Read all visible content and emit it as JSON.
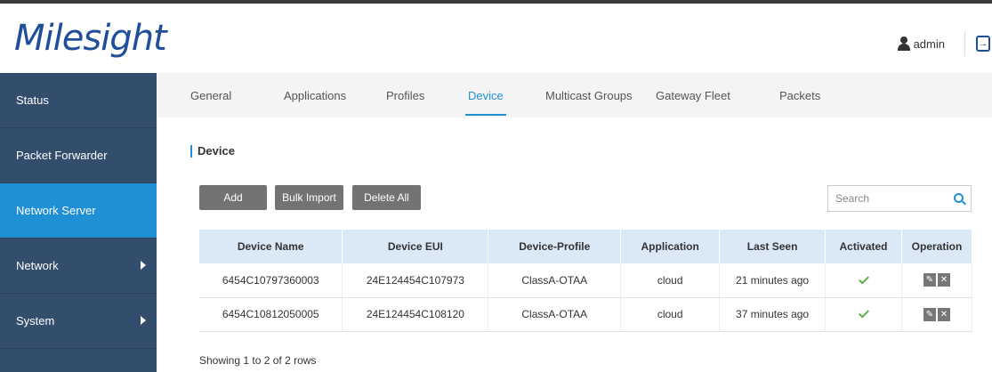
{
  "header": {
    "logo": "Milesight",
    "user": "admin"
  },
  "sidebar": {
    "items": [
      {
        "label": "Status"
      },
      {
        "label": "Packet Forwarder"
      },
      {
        "label": "Network Server"
      },
      {
        "label": "Network"
      },
      {
        "label": "System"
      }
    ]
  },
  "tabs": [
    "General",
    "Applications",
    "Profiles",
    "Device",
    "Multicast Groups",
    "Gateway Fleet",
    "Packets"
  ],
  "content": {
    "title": "Device",
    "buttons": {
      "add": "Add",
      "bulk_import": "Bulk Import",
      "delete_all": "Delete All"
    },
    "search_placeholder": "Search",
    "table": {
      "headers": [
        "Device Name",
        "Device EUI",
        "Device-Profile",
        "Application",
        "Last Seen",
        "Activated",
        "Operation"
      ],
      "rows": [
        [
          "6454C10797360003",
          "24E124454C107973",
          "ClassA-OTAA",
          "cloud",
          "21 minutes ago"
        ],
        [
          "6454C10812050005",
          "24E124454C108120",
          "ClassA-OTAA",
          "cloud",
          "37 minutes ago"
        ]
      ]
    },
    "footer": "Showing 1 to 2 of 2 rows"
  },
  "colors": {
    "sidebar": "#334d6d",
    "active": "#1f8fd6",
    "brand": "#1f4e9b"
  }
}
